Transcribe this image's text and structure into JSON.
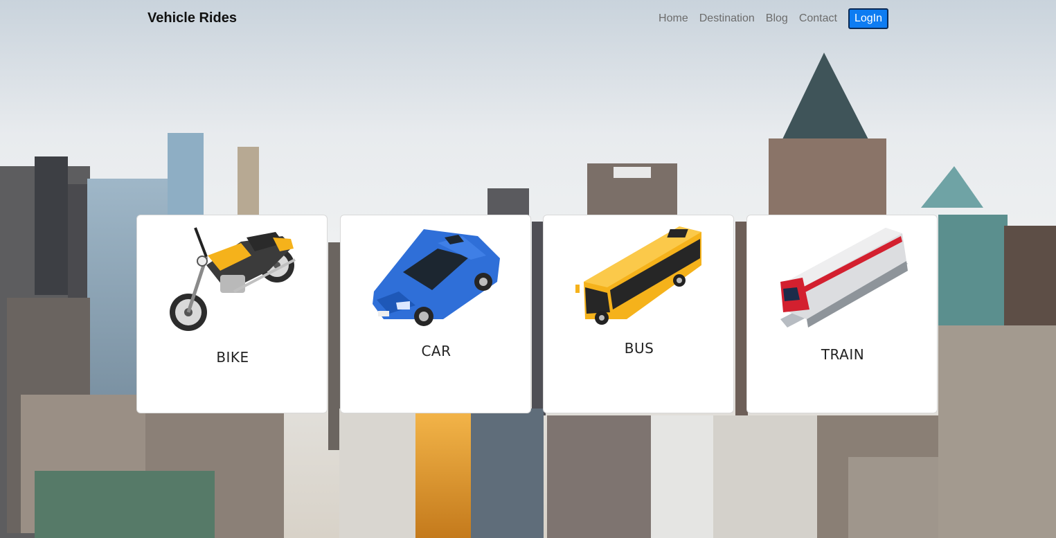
{
  "navbar": {
    "brand": "Vehicle Rides",
    "links": [
      "Home",
      "Destination",
      "Blog",
      "Contact"
    ],
    "login_label": "LogIn"
  },
  "cards": [
    {
      "title": "BIKE",
      "icon": "motorcycle-icon"
    },
    {
      "title": "CAR",
      "icon": "car-icon"
    },
    {
      "title": "BUS",
      "icon": "bus-icon"
    },
    {
      "title": "TRAIN",
      "icon": "train-icon"
    }
  ],
  "colors": {
    "login_button": "#0d7cf2",
    "vehicle_yellow": "#f5b21b",
    "car_blue": "#2f6fd8",
    "train_red": "#d3202f"
  }
}
